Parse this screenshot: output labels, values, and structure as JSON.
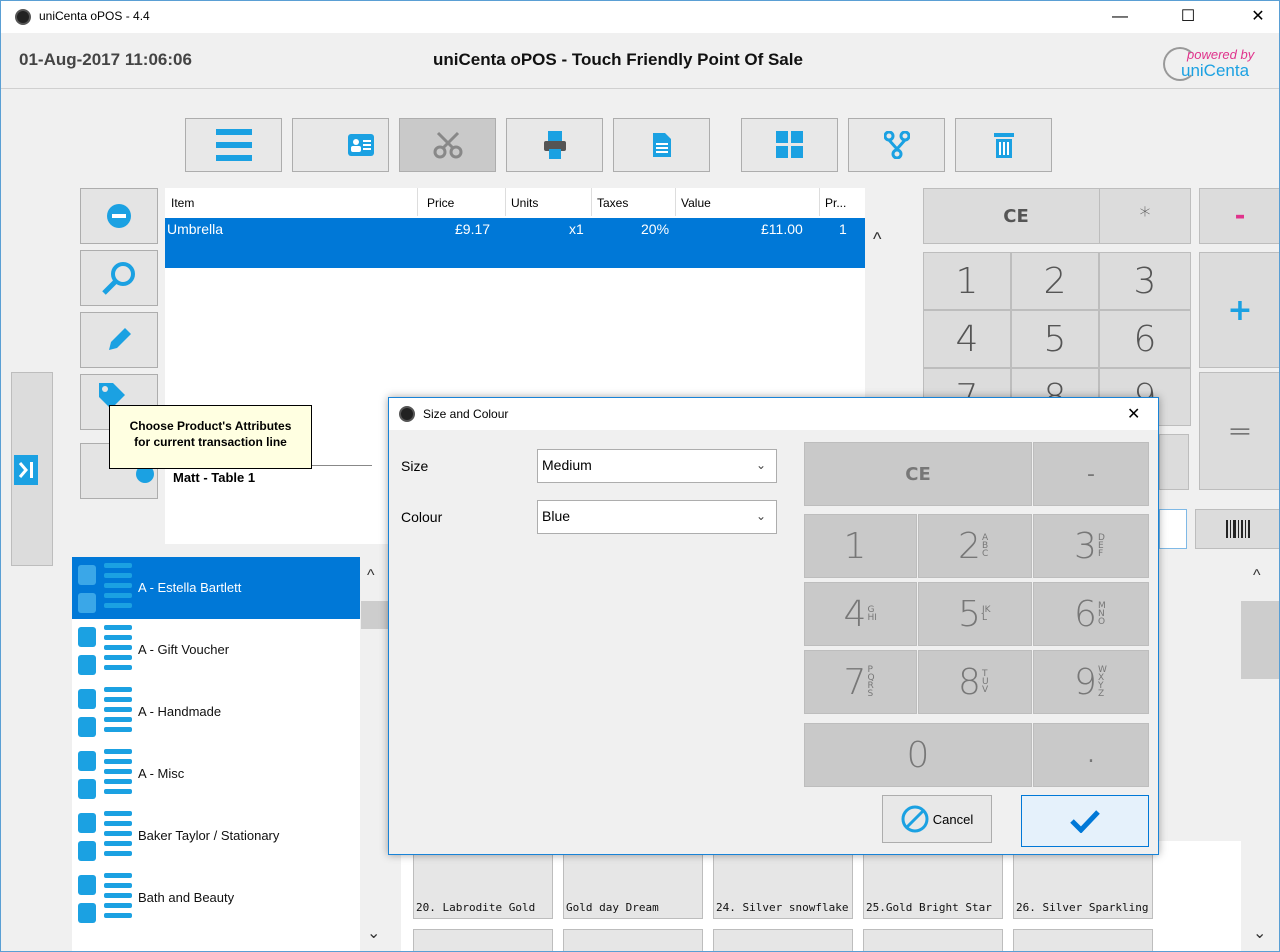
{
  "window": {
    "title": "uniCenta oPOS - 4.4",
    "minimize": "—",
    "maximize": "☐",
    "close": "✕"
  },
  "header": {
    "datetime": "01-Aug-2017 11:06:06",
    "title": "uniCenta oPOS - Touch Friendly Point Of Sale",
    "powered_by": "powered by",
    "brand": "uniCenta"
  },
  "ticket": {
    "columns": [
      "Item",
      "Price",
      "Units",
      "Taxes",
      "Value",
      "Pr..."
    ],
    "rows": [
      {
        "item": "Umbrella",
        "price": "£9.17",
        "units": "x1",
        "taxes": "20%",
        "value": "£11.00",
        "pr": "1"
      }
    ],
    "customer": "Matt - Table 1"
  },
  "keypad": {
    "ce": "CE",
    "multiply": "*",
    "minus": "-",
    "plus": "+",
    "equals": "=",
    "digits": [
      "1",
      "2",
      "3",
      "4",
      "5",
      "6",
      "7",
      "8",
      "9"
    ]
  },
  "tooltip": {
    "line1": "Choose Product's Attributes",
    "line2": "for current transaction line"
  },
  "categories": [
    {
      "label": "A - Estella Bartlett",
      "selected": true
    },
    {
      "label": "A - Gift Voucher",
      "selected": false
    },
    {
      "label": "A - Handmade",
      "selected": false
    },
    {
      "label": "A - Misc",
      "selected": false
    },
    {
      "label": "Baker Taylor / Stationary",
      "selected": false
    },
    {
      "label": "Bath and Beauty",
      "selected": false
    }
  ],
  "products": [
    "20. Labrodite Gold",
    "Gold day Dream",
    "24. Silver snowflake",
    "25.Gold Bright Star",
    "26. Silver Sparkling"
  ],
  "dialog": {
    "title": "Size and Colour",
    "close": "✕",
    "fields": [
      {
        "label": "Size",
        "value": "Medium"
      },
      {
        "label": "Colour",
        "value": "Blue"
      }
    ],
    "keypad": {
      "ce": "CE",
      "minus": "-",
      "zero": "0",
      "dot": ".",
      "keys": [
        {
          "d": "1",
          "l": ""
        },
        {
          "d": "2",
          "l": "ABC"
        },
        {
          "d": "3",
          "l": "DEF"
        },
        {
          "d": "4",
          "l": "GHI"
        },
        {
          "d": "5",
          "l": "JKL"
        },
        {
          "d": "6",
          "l": "MNO"
        },
        {
          "d": "7",
          "l": "PQRS"
        },
        {
          "d": "8",
          "l": "TUV"
        },
        {
          "d": "9",
          "l": "WXYZ"
        }
      ]
    },
    "cancel": "Cancel"
  },
  "colors": {
    "accent": "#0078d7",
    "icon_blue": "#1ba1e2",
    "pink": "#e0338c",
    "tooltip_bg": "#ffffe1"
  }
}
